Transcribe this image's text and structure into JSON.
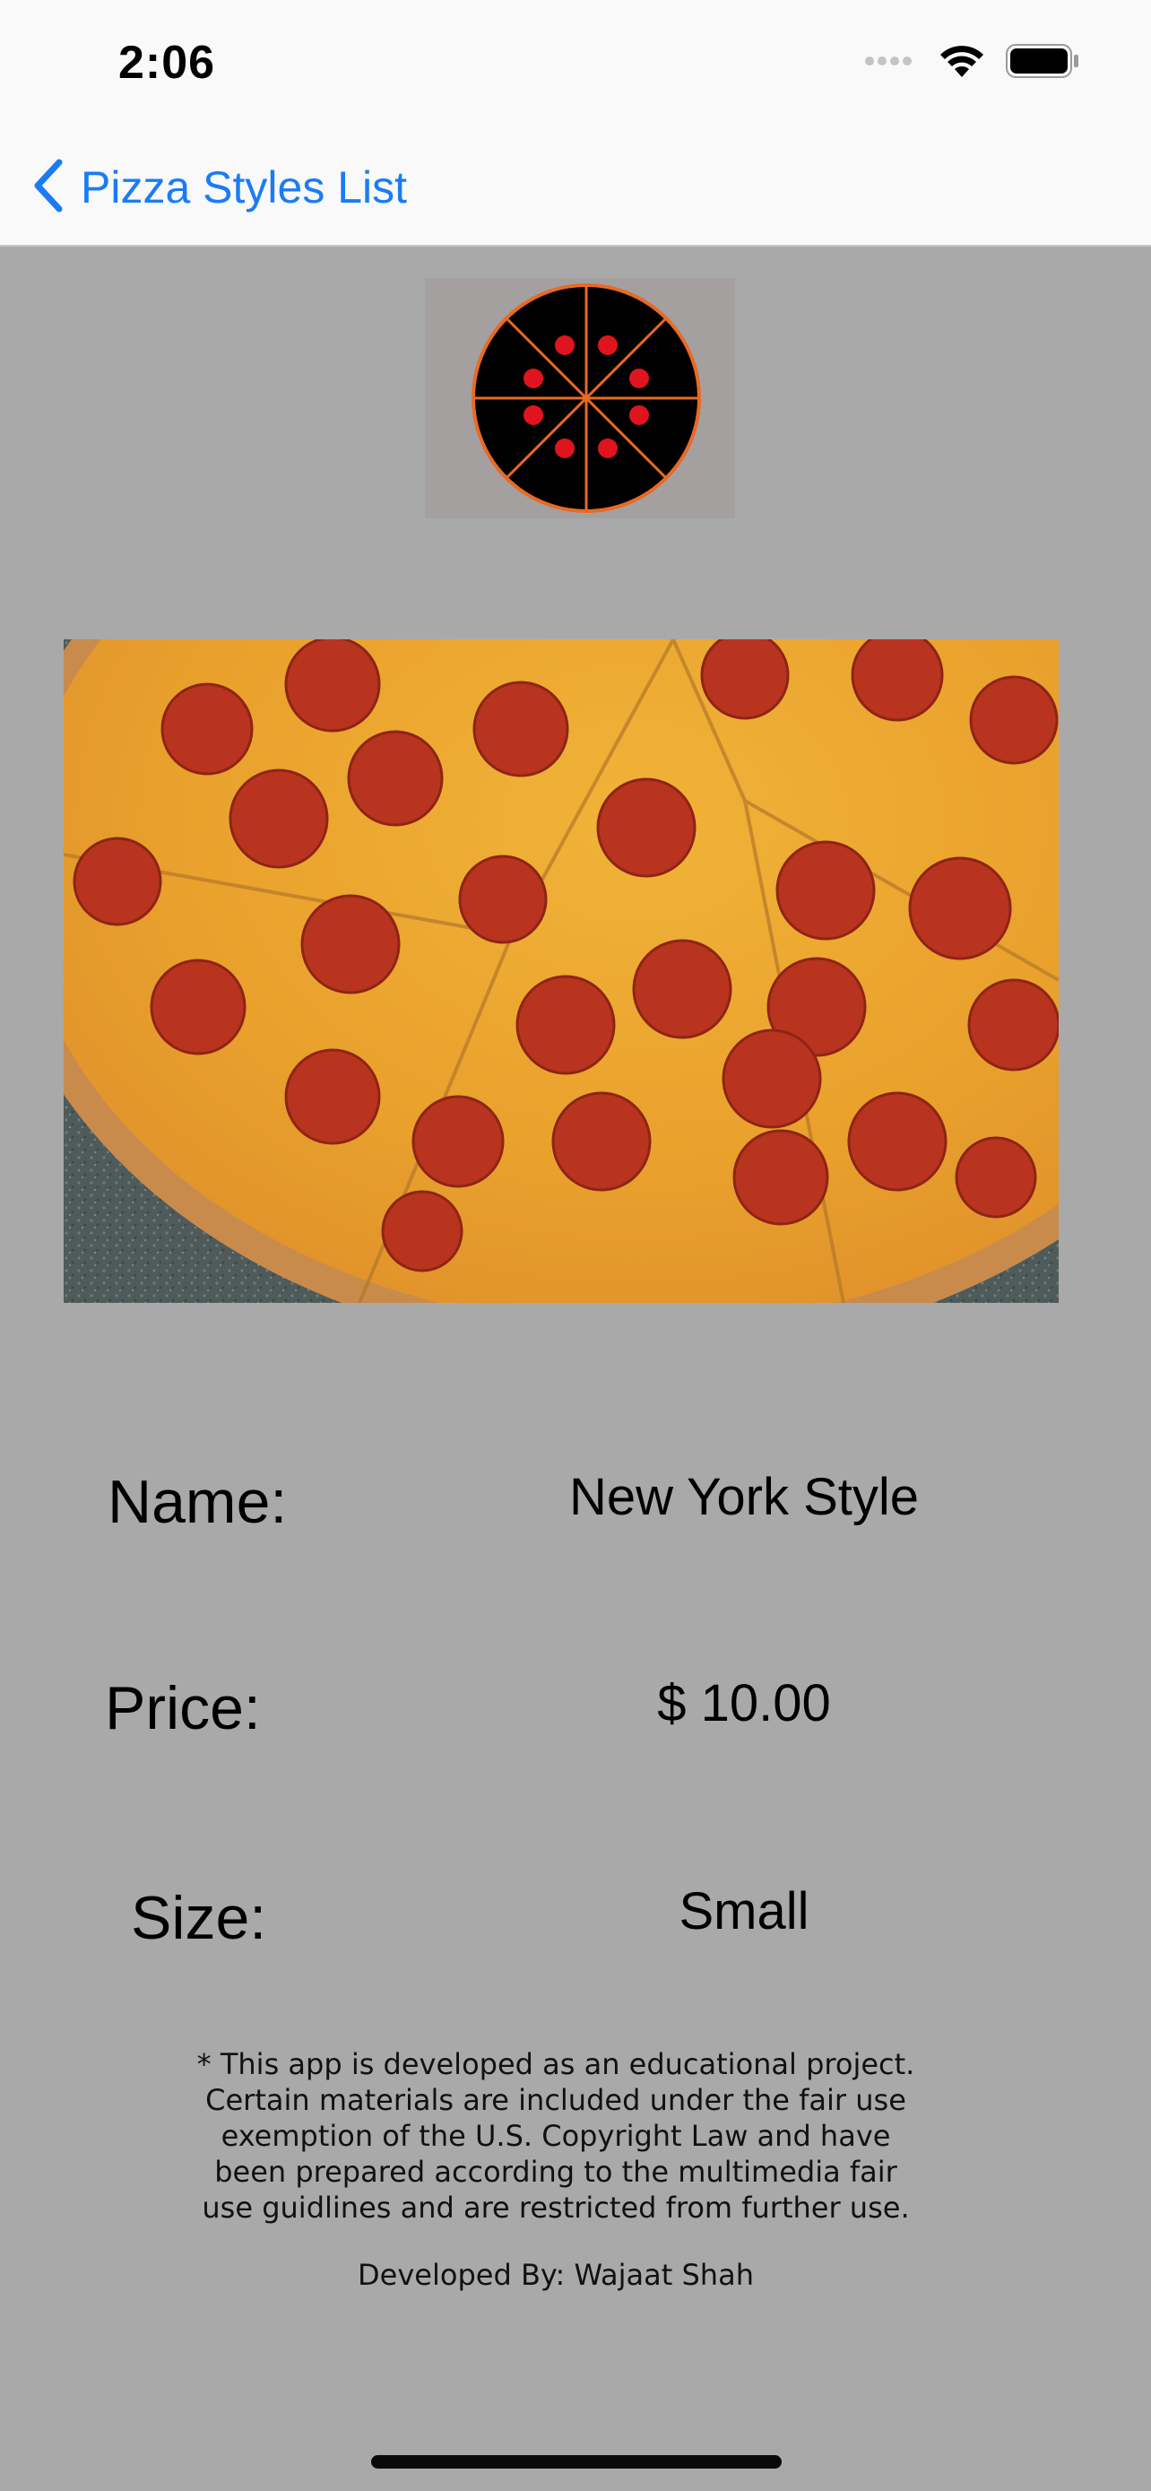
{
  "status_bar": {
    "time": "2:06",
    "signal_icon": "signal-dots-icon",
    "wifi_icon": "wifi-icon",
    "battery_icon": "battery-icon"
  },
  "nav": {
    "back_label": "Pizza Styles List",
    "back_icon": "chevron-left-icon",
    "accent_color": "#1a7cf5"
  },
  "logo": {
    "icon": "pizza-logo-icon"
  },
  "photo": {
    "subject": "pepperoni-pizza-photo"
  },
  "details": {
    "name_label": "Name:",
    "name_value": "New York Style",
    "price_label": "Price:",
    "price_value": "$ 10.00",
    "size_label": "Size:",
    "size_value": "Small"
  },
  "footer": {
    "disclaimer_lines": [
      "* This app is developed as an educational project.",
      "Certain materials are included under the fair use",
      "exemption of the U.S. Copyright Law and have",
      "been prepared according to the multimedia fair",
      "use guidlines and are restricted from further use."
    ],
    "developer": "Developed By: Wajaat Shah"
  },
  "colors": {
    "background": "#a9a9a9",
    "bar_background": "#f9f9f9"
  }
}
